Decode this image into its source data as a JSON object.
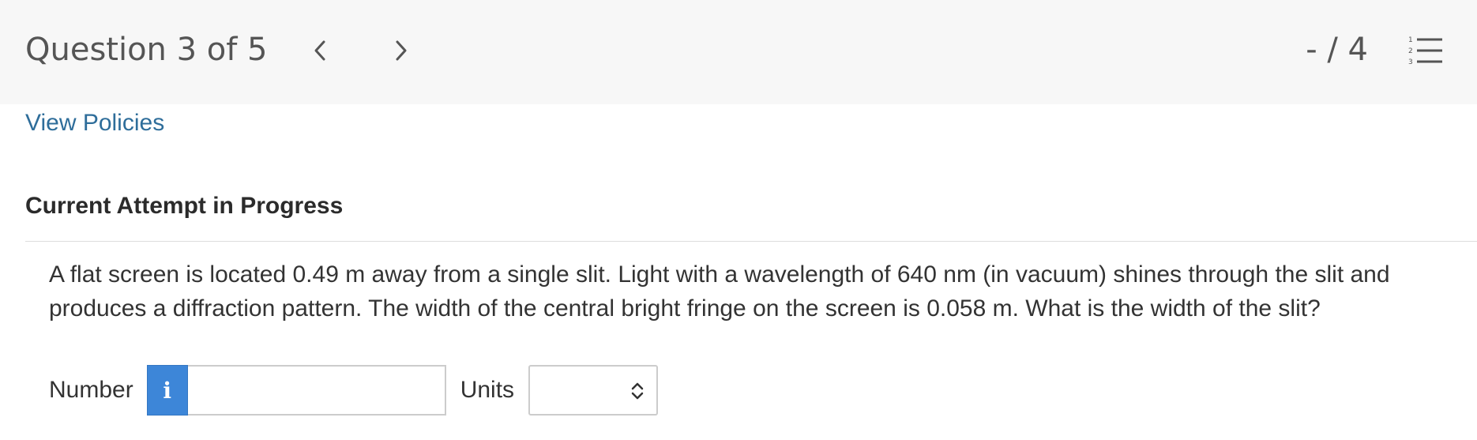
{
  "header": {
    "question_counter": "Question 3 of 5",
    "prev_icon": "chevron-left-icon",
    "next_icon": "chevron-right-icon",
    "score": "- / 4",
    "list_icon": "numbered-list-icon"
  },
  "links": {
    "view_policies": "View Policies"
  },
  "attempt": {
    "heading": "Current Attempt in Progress"
  },
  "question": {
    "text": "A flat screen is located 0.49 m away from a single slit. Light with a wavelength of 640 nm (in vacuum) shines through the slit and produces a diffraction pattern. The width of the central bright fringe on the screen is 0.058 m. What is the width of the slit?"
  },
  "answer": {
    "number_label": "Number",
    "info_glyph": "i",
    "number_value": "",
    "units_label": "Units",
    "units_selected": ""
  },
  "colors": {
    "topbar_bg": "#f7f7f7",
    "link": "#2e6d9a",
    "info_button": "#3d86d8"
  }
}
